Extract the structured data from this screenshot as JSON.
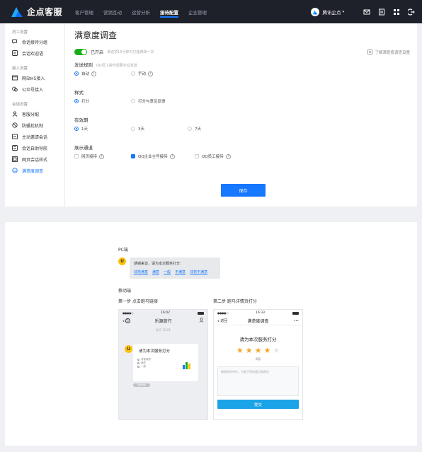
{
  "app": {
    "brand": "企点客服",
    "accent": "#1677ff",
    "nav_bg": "#1e2129"
  },
  "topnav": {
    "menu": [
      "客户管理",
      "营销互动",
      "运营分析",
      "接待配置",
      "企业管理"
    ],
    "active_index": 3,
    "user": "腾讯企点",
    "icons": [
      "mail-icon",
      "doc-icon",
      "apps-icon",
      "logout-icon"
    ]
  },
  "sidebar": {
    "groups": [
      {
        "title": "员工设置",
        "items": [
          {
            "label": "会话接待分组",
            "icon": "chat-group-icon"
          },
          {
            "label": "会话欢迎语",
            "icon": "welcome-icon"
          }
        ]
      },
      {
        "title": "接入设置",
        "items": [
          {
            "label": "网站H5接入",
            "icon": "web-icon"
          },
          {
            "label": "公众号接入",
            "icon": "official-account-icon"
          }
        ]
      },
      {
        "title": "会话设置",
        "items": [
          {
            "label": "客服分配",
            "icon": "assign-icon"
          },
          {
            "label": "防骚扰机制",
            "icon": "anti-harass-icon"
          },
          {
            "label": "主动邀请会话",
            "icon": "invite-icon"
          },
          {
            "label": "会话自助导航",
            "icon": "nav-icon"
          },
          {
            "label": "网页会话样式",
            "icon": "style-icon"
          },
          {
            "label": "满意度调查",
            "icon": "smile-icon",
            "active": true
          }
        ]
      }
    ]
  },
  "settings": {
    "title": "满意度调查",
    "switch_label": "已开启",
    "switch_hint": "该选项15分钟内只能修改一次",
    "learn_link": "了解满意度调查设置",
    "send_rule": {
      "label": "发送规则",
      "hint": "QQ员工操作需要手动发送",
      "options": [
        "自动",
        "手动"
      ],
      "selected": 0
    },
    "style": {
      "label": "样式",
      "options": [
        "打分",
        "打分与意见反馈"
      ],
      "selected": 0
    },
    "validity": {
      "label": "有效期",
      "options": [
        "1天",
        "3天",
        "7天"
      ],
      "selected": 0
    },
    "channels": {
      "label": "展示通道",
      "options": [
        "网页接待",
        "QQ企业主号接待",
        "QQ员工接待"
      ],
      "checked": [
        false,
        true,
        false
      ]
    },
    "save": "保存"
  },
  "preview": {
    "pc_label": "PC端",
    "pc_avatar": "U",
    "pc_prompt": "感谢来访，请为本次服务打分：",
    "pc_links": [
      "非常满意",
      "满意",
      "一般",
      "不满意",
      "非常不满意"
    ],
    "mobile_label": "移动端",
    "step1": "第一步 点击跑马链接",
    "step2": "第二步 跑马详情页打分",
    "phone1": {
      "time": "16:02",
      "back": "5",
      "title": "乐源旅行",
      "msg_time": "昨天 15:01",
      "avatar": "U",
      "card_title": "请为本次服务打分",
      "card_opts": [
        "非常满意",
        "满意",
        "一般"
      ],
      "pill": "查看详情"
    },
    "phone2": {
      "time": "16:33",
      "back": "返回",
      "title": "满意度调查",
      "more": "•••",
      "rate_title": "请为本次服务打分",
      "stars_filled": 4,
      "stars_total": 5,
      "rate_word": "满意",
      "feedback_placeholder": "感谢您的评价，可留下您的意见和建议",
      "submit": "提交"
    }
  }
}
